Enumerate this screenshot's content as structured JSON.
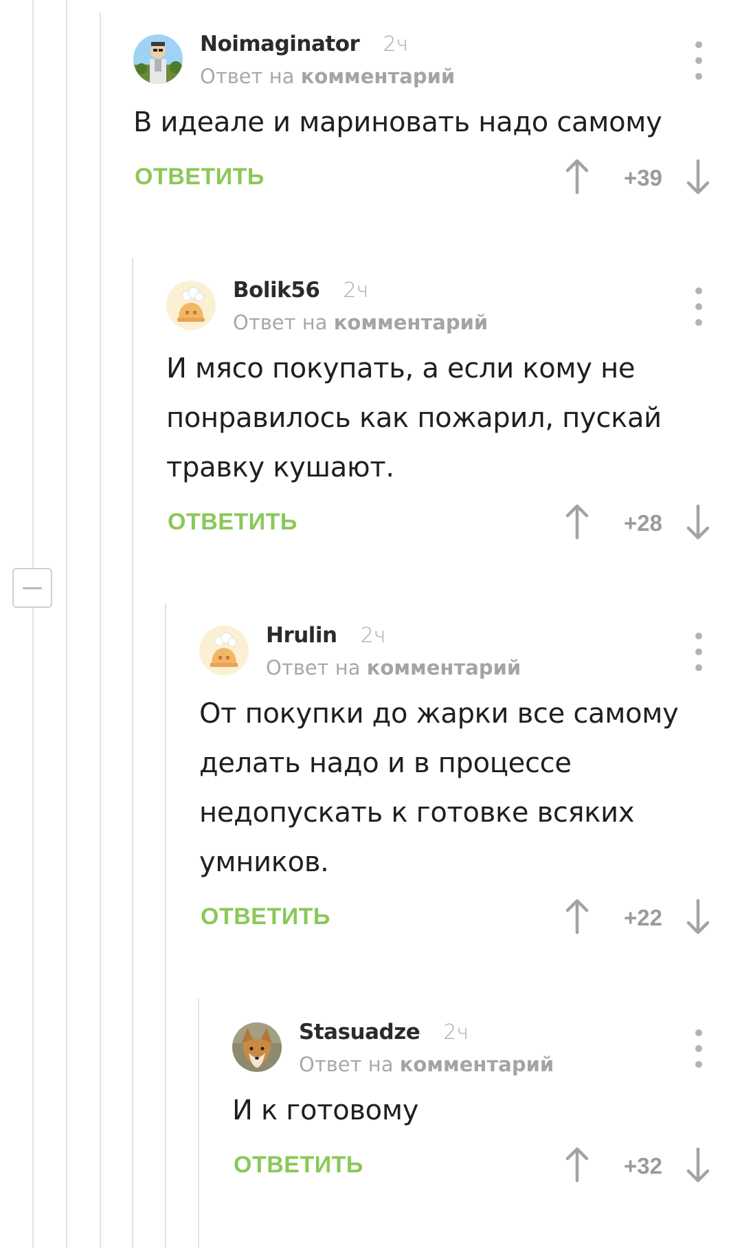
{
  "comments": [
    {
      "username": "Noimaginator",
      "time": "2ч",
      "reply_prefix": "Ответ на",
      "reply_link": "комментарий",
      "body": "В идеале и мариновать надо самому",
      "reply_label": "ОТВЕТИТЬ",
      "score": "+39"
    },
    {
      "username": "Bolik56",
      "time": "2ч",
      "reply_prefix": "Ответ на",
      "reply_link": "комментарий",
      "body": "И мясо покупать, а если кому не понравилось как пожарил, пускай травку кушают.",
      "reply_label": "ОТВЕТИТЬ",
      "score": "+28"
    },
    {
      "username": "Hrulin",
      "time": "2ч",
      "reply_prefix": "Ответ на",
      "reply_link": "комментарий",
      "body": "От покупки до жарки все самому делать надо и в процессе недопускать к готовке всяких умников.",
      "reply_label": "ОТВЕТИТЬ",
      "score": "+22"
    },
    {
      "username": "Stasuadze",
      "time": "2ч",
      "reply_prefix": "Ответ на",
      "reply_link": "комментарий",
      "body": "И к готовому",
      "reply_label": "ОТВЕТИТЬ",
      "score": "+32"
    }
  ],
  "colors": {
    "accent_green": "#8ac858",
    "muted_text": "#a8a8a8",
    "thread_line": "#e2e2e2"
  },
  "icons": {
    "vote_up": "arrow-up-icon",
    "vote_down": "arrow-down-icon",
    "more": "more-vertical-icon",
    "collapse": "minus-icon"
  }
}
